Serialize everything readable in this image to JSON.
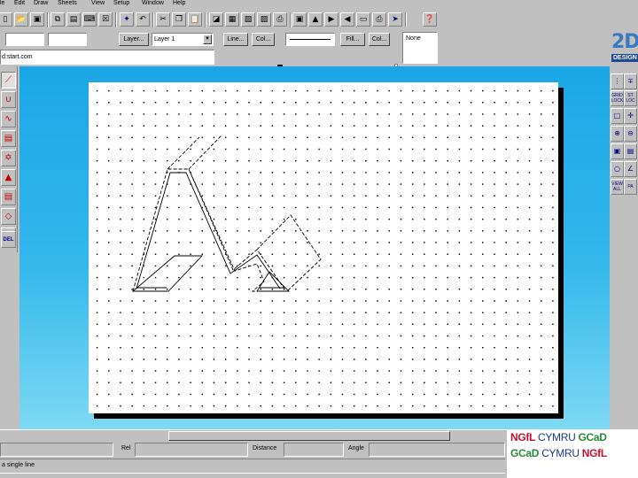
{
  "menu": {
    "items": [
      "le",
      "Edit",
      "Draw",
      "Sheets",
      "View",
      "Setup",
      "Window",
      "Help"
    ]
  },
  "properties": {
    "layer_button": "Layer...",
    "layer_value": "Layer 1",
    "line_button": "Line...",
    "col_button": "Col...",
    "fill_button": "Fill...",
    "col2_button": "Col...",
    "fill_value": "None"
  },
  "address_bar": {
    "value": "d:start.com"
  },
  "logo": {
    "big": "2D",
    "strip": "DESIGN"
  },
  "right_palette": {
    "grid_label": "GRID LOCK",
    "snap_label": "ST LOC",
    "view_label": "VIEW ALL",
    "page_label": "PA"
  },
  "left_palette": {
    "del_label": "DEL"
  },
  "coords": {
    "rel_label": "Rel",
    "distance_label": "Distance",
    "angle_label": "Angle"
  },
  "status": {
    "text": "a single line"
  },
  "banner": {
    "line1_a": "NGfL",
    "line1_b": "CYMRU",
    "line1_c": "GCaD",
    "line2_a": "GCaD",
    "line2_b": "CYMRU",
    "line2_c": "NGfL"
  },
  "colors": {
    "workspace_top": "#1aa6e6",
    "workspace_bottom": "#7fd9f4",
    "ngfl_red": "#c8102e",
    "gcad_green": "#2a8a3a"
  }
}
